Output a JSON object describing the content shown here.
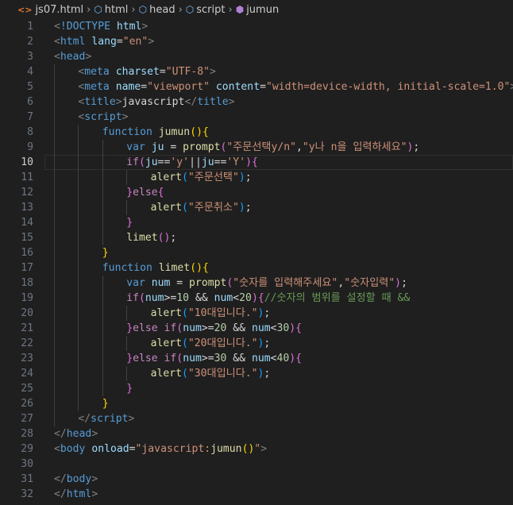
{
  "breadcrumb": {
    "file": "js07.html",
    "html": "html",
    "head": "head",
    "script": "script",
    "func": "jumun"
  },
  "editor": {
    "current_line": 10,
    "lines": [
      {
        "n": "1",
        "indent": 0,
        "tokens": [
          [
            "p",
            "<"
          ],
          [
            "t",
            "!DOCTYPE"
          ],
          [
            "x",
            " "
          ],
          [
            "a",
            "html"
          ],
          [
            "p",
            ">"
          ]
        ]
      },
      {
        "n": "2",
        "indent": 0,
        "tokens": [
          [
            "p",
            "<"
          ],
          [
            "t",
            "html"
          ],
          [
            "x",
            " "
          ],
          [
            "a",
            "lang"
          ],
          [
            "x",
            "="
          ],
          [
            "s",
            "\"en\""
          ],
          [
            "p",
            ">"
          ]
        ]
      },
      {
        "n": "3",
        "indent": 0,
        "tokens": [
          [
            "p",
            "<"
          ],
          [
            "t",
            "head"
          ],
          [
            "p",
            ">"
          ]
        ]
      },
      {
        "n": "4",
        "indent": 1,
        "tokens": [
          [
            "p",
            "<"
          ],
          [
            "t",
            "meta"
          ],
          [
            "x",
            " "
          ],
          [
            "a",
            "charset"
          ],
          [
            "x",
            "="
          ],
          [
            "s",
            "\"UTF-8\""
          ],
          [
            "p",
            ">"
          ]
        ]
      },
      {
        "n": "5",
        "indent": 1,
        "tokens": [
          [
            "p",
            "<"
          ],
          [
            "t",
            "meta"
          ],
          [
            "x",
            " "
          ],
          [
            "a",
            "name"
          ],
          [
            "x",
            "="
          ],
          [
            "s",
            "\"viewport\""
          ],
          [
            "x",
            " "
          ],
          [
            "a",
            "content"
          ],
          [
            "x",
            "="
          ],
          [
            "s",
            "\"width=device-width, initial-scale=1.0\""
          ],
          [
            "p",
            ">"
          ]
        ]
      },
      {
        "n": "6",
        "indent": 1,
        "tokens": [
          [
            "p",
            "<"
          ],
          [
            "t",
            "title"
          ],
          [
            "p",
            ">"
          ],
          [
            "x",
            "javascript"
          ],
          [
            "p",
            "</"
          ],
          [
            "t",
            "title"
          ],
          [
            "p",
            ">"
          ]
        ]
      },
      {
        "n": "7",
        "indent": 1,
        "tokens": [
          [
            "p",
            "<"
          ],
          [
            "t",
            "script"
          ],
          [
            "p",
            ">"
          ]
        ]
      },
      {
        "n": "8",
        "indent": 2,
        "tokens": [
          [
            "t",
            "function"
          ],
          [
            "x",
            " "
          ],
          [
            "f",
            "jumun"
          ],
          [
            "b1",
            "()"
          ],
          [
            "b1",
            "{"
          ]
        ]
      },
      {
        "n": "9",
        "indent": 3,
        "tokens": [
          [
            "t",
            "var"
          ],
          [
            "x",
            " "
          ],
          [
            "a",
            "ju"
          ],
          [
            "x",
            " = "
          ],
          [
            "f",
            "prompt"
          ],
          [
            "b2",
            "("
          ],
          [
            "s",
            "\"주문선택y/n\""
          ],
          [
            "x",
            ","
          ],
          [
            "s",
            "\"y나 n을 입력하세요\""
          ],
          [
            "b2",
            ")"
          ],
          [
            "x",
            ";"
          ]
        ]
      },
      {
        "n": "10",
        "indent": 3,
        "tokens": [
          [
            "k",
            "if"
          ],
          [
            "b2",
            "("
          ],
          [
            "a",
            "ju"
          ],
          [
            "x",
            "=="
          ],
          [
            "s",
            "'y'"
          ],
          [
            "x",
            "||"
          ],
          [
            "a",
            "ju"
          ],
          [
            "x",
            "=="
          ],
          [
            "s",
            "'Y'"
          ],
          [
            "b2",
            ")"
          ],
          [
            "b2",
            "{"
          ]
        ]
      },
      {
        "n": "11",
        "indent": 4,
        "tokens": [
          [
            "f",
            "alert"
          ],
          [
            "b3",
            "("
          ],
          [
            "s",
            "\"주문선택\""
          ],
          [
            "b3",
            ")"
          ],
          [
            "x",
            ";"
          ]
        ]
      },
      {
        "n": "12",
        "indent": 3,
        "tokens": [
          [
            "b2",
            "}"
          ],
          [
            "k",
            "else"
          ],
          [
            "b2",
            "{"
          ]
        ]
      },
      {
        "n": "13",
        "indent": 4,
        "tokens": [
          [
            "f",
            "alert"
          ],
          [
            "b3",
            "("
          ],
          [
            "s",
            "\"주문취소\""
          ],
          [
            "b3",
            ")"
          ],
          [
            "x",
            ";"
          ]
        ]
      },
      {
        "n": "14",
        "indent": 3,
        "tokens": [
          [
            "b2",
            "}"
          ]
        ]
      },
      {
        "n": "15",
        "indent": 3,
        "tokens": [
          [
            "f",
            "limet"
          ],
          [
            "b2",
            "()"
          ],
          [
            "x",
            ";"
          ]
        ]
      },
      {
        "n": "16",
        "indent": 2,
        "tokens": [
          [
            "b1",
            "}"
          ]
        ]
      },
      {
        "n": "17",
        "indent": 2,
        "tokens": [
          [
            "t",
            "function"
          ],
          [
            "x",
            " "
          ],
          [
            "f",
            "limet"
          ],
          [
            "b1",
            "()"
          ],
          [
            "b1",
            "{"
          ]
        ]
      },
      {
        "n": "18",
        "indent": 3,
        "tokens": [
          [
            "t",
            "var"
          ],
          [
            "x",
            " "
          ],
          [
            "a",
            "num"
          ],
          [
            "x",
            " = "
          ],
          [
            "f",
            "prompt"
          ],
          [
            "b2",
            "("
          ],
          [
            "s",
            "\"숫자를 입력해주세요\""
          ],
          [
            "x",
            ","
          ],
          [
            "s",
            "\"숫자입력\""
          ],
          [
            "b2",
            ")"
          ],
          [
            "x",
            ";"
          ]
        ]
      },
      {
        "n": "19",
        "indent": 3,
        "tokens": [
          [
            "k",
            "if"
          ],
          [
            "b2",
            "("
          ],
          [
            "a",
            "num"
          ],
          [
            "x",
            ">="
          ],
          [
            "n",
            "10"
          ],
          [
            "x",
            " && "
          ],
          [
            "a",
            "num"
          ],
          [
            "x",
            "<"
          ],
          [
            "n",
            "20"
          ],
          [
            "b2",
            ")"
          ],
          [
            "b2",
            "{"
          ],
          [
            "c",
            "//숫자의 범위를 설정할 때 &&"
          ]
        ]
      },
      {
        "n": "20",
        "indent": 4,
        "tokens": [
          [
            "f",
            "alert"
          ],
          [
            "b3",
            "("
          ],
          [
            "s",
            "\"10대입니다.\""
          ],
          [
            "b3",
            ")"
          ],
          [
            "x",
            ";"
          ]
        ]
      },
      {
        "n": "21",
        "indent": 3,
        "tokens": [
          [
            "b2",
            "}"
          ],
          [
            "k",
            "else"
          ],
          [
            "x",
            " "
          ],
          [
            "k",
            "if"
          ],
          [
            "b2",
            "("
          ],
          [
            "a",
            "num"
          ],
          [
            "x",
            ">="
          ],
          [
            "n",
            "20"
          ],
          [
            "x",
            " && "
          ],
          [
            "a",
            "num"
          ],
          [
            "x",
            "<"
          ],
          [
            "n",
            "30"
          ],
          [
            "b2",
            ")"
          ],
          [
            "b2",
            "{"
          ]
        ]
      },
      {
        "n": "22",
        "indent": 4,
        "tokens": [
          [
            "f",
            "alert"
          ],
          [
            "b3",
            "("
          ],
          [
            "s",
            "\"20대입니다.\""
          ],
          [
            "b3",
            ")"
          ],
          [
            "x",
            ";"
          ]
        ]
      },
      {
        "n": "23",
        "indent": 3,
        "tokens": [
          [
            "b2",
            "}"
          ],
          [
            "k",
            "else"
          ],
          [
            "x",
            " "
          ],
          [
            "k",
            "if"
          ],
          [
            "b2",
            "("
          ],
          [
            "a",
            "num"
          ],
          [
            "x",
            ">="
          ],
          [
            "n",
            "30"
          ],
          [
            "x",
            " && "
          ],
          [
            "a",
            "num"
          ],
          [
            "x",
            "<"
          ],
          [
            "n",
            "40"
          ],
          [
            "b2",
            ")"
          ],
          [
            "b2",
            "{"
          ]
        ]
      },
      {
        "n": "24",
        "indent": 4,
        "tokens": [
          [
            "f",
            "alert"
          ],
          [
            "b3",
            "("
          ],
          [
            "s",
            "\"30대입니다.\""
          ],
          [
            "b3",
            ")"
          ],
          [
            "x",
            ";"
          ]
        ]
      },
      {
        "n": "25",
        "indent": 3,
        "tokens": [
          [
            "b2",
            "}"
          ]
        ]
      },
      {
        "n": "26",
        "indent": 2,
        "tokens": [
          [
            "b1",
            "}"
          ]
        ]
      },
      {
        "n": "27",
        "indent": 1,
        "tokens": [
          [
            "p",
            "</"
          ],
          [
            "t",
            "script"
          ],
          [
            "p",
            ">"
          ]
        ]
      },
      {
        "n": "28",
        "indent": 0,
        "tokens": [
          [
            "p",
            "</"
          ],
          [
            "t",
            "head"
          ],
          [
            "p",
            ">"
          ]
        ]
      },
      {
        "n": "29",
        "indent": 0,
        "tokens": [
          [
            "p",
            "<"
          ],
          [
            "t",
            "body"
          ],
          [
            "x",
            " "
          ],
          [
            "a",
            "onload"
          ],
          [
            "x",
            "="
          ],
          [
            "s",
            "\"javascript:"
          ],
          [
            "f",
            "jumun"
          ],
          [
            "b1",
            "()"
          ],
          [
            "s",
            "\""
          ],
          [
            "p",
            ">"
          ]
        ]
      },
      {
        "n": "30",
        "indent": 0,
        "tokens": []
      },
      {
        "n": "31",
        "indent": 0,
        "tokens": [
          [
            "p",
            "</"
          ],
          [
            "t",
            "body"
          ],
          [
            "p",
            ">"
          ]
        ]
      },
      {
        "n": "32",
        "indent": 0,
        "tokens": [
          [
            "p",
            "</"
          ],
          [
            "t",
            "html"
          ],
          [
            "p",
            ">"
          ]
        ]
      }
    ]
  }
}
